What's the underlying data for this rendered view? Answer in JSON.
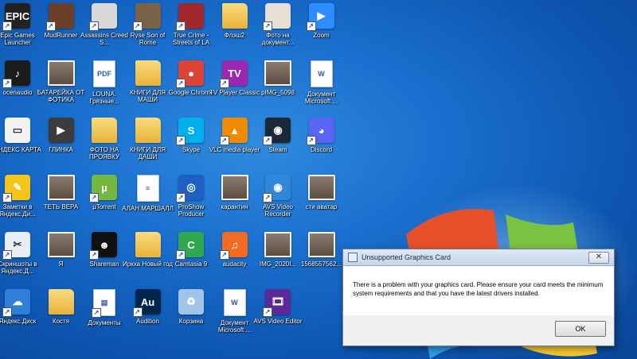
{
  "desktop": {
    "icons": [
      {
        "label": "Epic Games Launcher",
        "icon": "epic-games-icon",
        "glyph": "EPIC",
        "kind": "app",
        "color": "#222222",
        "shortcut": true
      },
      {
        "label": "MudRunner",
        "icon": "mudrunner-icon",
        "glyph": "",
        "kind": "app",
        "color": "#6b3f2a",
        "shortcut": true
      },
      {
        "label": "Assassins Creed S...",
        "icon": "assassins-creed-icon",
        "glyph": "",
        "kind": "app",
        "color": "#d8d8d8",
        "shortcut": true
      },
      {
        "label": "Ryse Son of Rome",
        "icon": "ryse-icon",
        "glyph": "",
        "kind": "app",
        "color": "#7a6248",
        "shortcut": true
      },
      {
        "label": "True Crime - Streets of LA",
        "icon": "true-crime-icon",
        "glyph": "",
        "kind": "app",
        "color": "#a0282a",
        "shortcut": true
      },
      {
        "label": "Флэш2",
        "icon": "folder-icon",
        "glyph": "",
        "kind": "folder",
        "color": "#e8b83e",
        "shortcut": false
      },
      {
        "label": "Фото на документ...",
        "icon": "photo-doc-icon",
        "glyph": "",
        "kind": "app",
        "color": "#e6e0d4",
        "shortcut": true
      },
      {
        "label": "Zoom",
        "icon": "zoom-icon",
        "glyph": "▶",
        "kind": "app",
        "color": "#2d8cff",
        "shortcut": true
      },
      {
        "label": "ocenaudio",
        "icon": "ocenaudio-icon",
        "glyph": "♪",
        "kind": "app",
        "color": "#1c1c1c",
        "shortcut": true
      },
      {
        "label": "БАТАРЕЙКА ОТ ФОТИКА",
        "icon": "photo-icon",
        "glyph": "",
        "kind": "photo",
        "color": "#5c4e44",
        "shortcut": false
      },
      {
        "label": "LOUNA. Грязные...",
        "icon": "pdf-document-icon",
        "glyph": "PDF",
        "kind": "doc",
        "color": "#ffffff",
        "shortcut": false
      },
      {
        "label": "КНИГИ ДЛЯ МАШИ",
        "icon": "folder-icon",
        "glyph": "",
        "kind": "folder",
        "color": "#e8b83e",
        "shortcut": false
      },
      {
        "label": "Google Chrome",
        "icon": "chrome-icon",
        "glyph": "●",
        "kind": "app",
        "color": "#db4437",
        "shortcut": true
      },
      {
        "label": "TV Player Classic",
        "icon": "tv-player-icon",
        "glyph": "TV",
        "kind": "app",
        "color": "#9c27b0",
        "shortcut": true
      },
      {
        "label": "pIMG_5098",
        "icon": "photo-icon",
        "glyph": "",
        "kind": "photo",
        "color": "#5c4e44",
        "shortcut": false
      },
      {
        "label": "Документ Microsoft ...",
        "icon": "word-document-icon",
        "glyph": "W",
        "kind": "doc",
        "color": "#ffffff",
        "shortcut": false
      },
      {
        "label": "ЯНДЕКС КАРТА",
        "icon": "yandex-card-icon",
        "glyph": "▭",
        "kind": "app",
        "color": "#f2f2f2",
        "shortcut": false
      },
      {
        "label": "ГЛИНКА",
        "icon": "video-file-icon",
        "glyph": "▶",
        "kind": "app",
        "color": "#3c3c3c",
        "shortcut": false
      },
      {
        "label": "ФОТО НА ПРОЯВКУ",
        "icon": "folder-icon",
        "glyph": "",
        "kind": "folder",
        "color": "#e8b83e",
        "shortcut": false
      },
      {
        "label": "КНИГИ ДЛЯ ДАШИ",
        "icon": "folder-icon",
        "glyph": "",
        "kind": "folder",
        "color": "#e8b83e",
        "shortcut": false
      },
      {
        "label": "Skype",
        "icon": "skype-icon",
        "glyph": "S",
        "kind": "app",
        "color": "#00aff0",
        "shortcut": true
      },
      {
        "label": "VLC media player",
        "icon": "vlc-icon",
        "glyph": "▲",
        "kind": "app",
        "color": "#f08a00",
        "shortcut": true
      },
      {
        "label": "Steam",
        "icon": "steam-icon",
        "glyph": "◉",
        "kind": "app",
        "color": "#1b2838",
        "shortcut": true
      },
      {
        "label": "Discord",
        "icon": "discord-icon",
        "glyph": "◕",
        "kind": "app",
        "color": "#5865f2",
        "shortcut": true
      },
      {
        "label": "Заметки в Яндекс.Ди...",
        "icon": "yandex-notes-icon",
        "glyph": "✎",
        "kind": "app",
        "color": "#f5c518",
        "shortcut": true
      },
      {
        "label": "ТЕТЬ ВЕРА",
        "icon": "photo-icon",
        "glyph": "",
        "kind": "photo",
        "color": "#5c4e44",
        "shortcut": false
      },
      {
        "label": "µTorrent",
        "icon": "utorrent-icon",
        "glyph": "µ",
        "kind": "app",
        "color": "#76b83f",
        "shortcut": true
      },
      {
        "label": "АЛАН МАРШАЛЛ",
        "icon": "text-file-icon",
        "glyph": "≡",
        "kind": "doc",
        "color": "#ffffff",
        "shortcut": false
      },
      {
        "label": "ProShow Producer",
        "icon": "proshow-icon",
        "glyph": "◎",
        "kind": "app",
        "color": "#1e5fbf",
        "shortcut": true
      },
      {
        "label": "карантин",
        "icon": "photo-icon",
        "glyph": "",
        "kind": "photo",
        "color": "#5c4e44",
        "shortcut": false
      },
      {
        "label": "AVS Video Recorder",
        "icon": "avs-recorder-icon",
        "glyph": "◉",
        "kind": "app",
        "color": "#2e87d8",
        "shortcut": true
      },
      {
        "label": "сти аватар",
        "icon": "photo-icon",
        "glyph": "",
        "kind": "photo",
        "color": "#1a1a1a",
        "shortcut": false
      },
      {
        "label": "Скриншоты в Яндекс.Д...",
        "icon": "yandex-screenshot-icon",
        "glyph": "✂",
        "kind": "app",
        "color": "#e8eef8",
        "shortcut": true
      },
      {
        "label": "Я",
        "icon": "photo-icon",
        "glyph": "",
        "kind": "photo",
        "color": "#5c4e44",
        "shortcut": false
      },
      {
        "label": "Shareman",
        "icon": "shareman-icon",
        "glyph": "☻",
        "kind": "app",
        "color": "#111111",
        "shortcut": true
      },
      {
        "label": "Иркха Новый год",
        "icon": "folder-icon",
        "glyph": "",
        "kind": "folder",
        "color": "#e8b83e",
        "shortcut": false
      },
      {
        "label": "Camtasia 9",
        "icon": "camtasia-icon",
        "glyph": "C",
        "kind": "app",
        "color": "#2fa84f",
        "shortcut": true
      },
      {
        "label": "audacity",
        "icon": "audacity-icon",
        "glyph": "♫",
        "kind": "app",
        "color": "#f36b21",
        "shortcut": true
      },
      {
        "label": "IMG_2020I...",
        "icon": "photo-icon",
        "glyph": "",
        "kind": "photo",
        "color": "#5c4e44",
        "shortcut": false
      },
      {
        "label": "1568557562...",
        "icon": "photo-icon",
        "glyph": "",
        "kind": "photo",
        "color": "#5c4e44",
        "shortcut": false
      },
      {
        "label": "Яндекс.Диск",
        "icon": "yandex-disk-icon",
        "glyph": "☁",
        "kind": "app",
        "color": "#2f7fd8",
        "shortcut": true
      },
      {
        "label": "Костя",
        "icon": "folder-icon",
        "glyph": "",
        "kind": "folder",
        "color": "#e8b83e",
        "shortcut": false
      },
      {
        "label": "Документы",
        "icon": "documents-shortcut-icon",
        "glyph": "▤",
        "kind": "doc",
        "color": "#ffffff",
        "shortcut": true
      },
      {
        "label": "Audition",
        "icon": "audition-icon",
        "glyph": "Au",
        "kind": "app",
        "color": "#00264d",
        "shortcut": true
      },
      {
        "label": "Корзина",
        "icon": "recycle-bin-icon",
        "glyph": "♻",
        "kind": "app",
        "color": "#9fc4e8",
        "shortcut": false
      },
      {
        "label": "Документ Microsoft ...",
        "icon": "word-document-icon",
        "glyph": "W",
        "kind": "doc",
        "color": "#ffffff",
        "shortcut": false
      },
      {
        "label": "AVS Video Editor",
        "icon": "avs-editor-icon",
        "glyph": "🎞",
        "kind": "app",
        "color": "#5a2a9a",
        "shortcut": true
      }
    ]
  },
  "dialog": {
    "title": "Unsupported Graphics Card",
    "message": "There is a problem with your graphics card. Please ensure your card meets the minimum system requirements and that you have the latest drivers installed.",
    "ok_label": "OK",
    "close_glyph": "✕"
  }
}
